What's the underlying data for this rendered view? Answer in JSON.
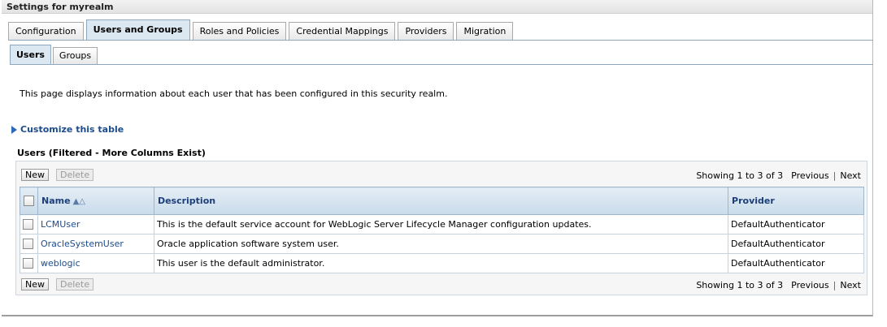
{
  "panel": {
    "title": "Settings for myrealm"
  },
  "tabs": [
    {
      "label": "Configuration",
      "active": false
    },
    {
      "label": "Users and Groups",
      "active": true
    },
    {
      "label": "Roles and Policies",
      "active": false
    },
    {
      "label": "Credential Mappings",
      "active": false
    },
    {
      "label": "Providers",
      "active": false
    },
    {
      "label": "Migration",
      "active": false
    }
  ],
  "subtabs": [
    {
      "label": "Users",
      "active": true
    },
    {
      "label": "Groups",
      "active": false
    }
  ],
  "intro": "This page displays information about each user that has been configured in this security realm.",
  "customize_link": "Customize this table",
  "table": {
    "caption": "Users (Filtered - More Columns Exist)",
    "new_label": "New",
    "delete_label": "Delete",
    "pager": {
      "showing": "Showing 1 to 3 of 3",
      "previous": "Previous",
      "next": "Next"
    },
    "columns": {
      "name": "Name",
      "description": "Description",
      "provider": "Provider"
    },
    "rows": [
      {
        "name": "LCMUser",
        "description": "This is the default service account for WebLogic Server Lifecycle Manager configuration updates.",
        "provider": "DefaultAuthenticator"
      },
      {
        "name": "OracleSystemUser",
        "description": "Oracle application software system user.",
        "provider": "DefaultAuthenticator"
      },
      {
        "name": "weblogic",
        "description": "This user is the default administrator.",
        "provider": "DefaultAuthenticator"
      }
    ]
  },
  "colors": {
    "link": "#1c4c8c",
    "header_bg": "#c9dbea",
    "active_tab_bg": "#dbe7f1"
  }
}
